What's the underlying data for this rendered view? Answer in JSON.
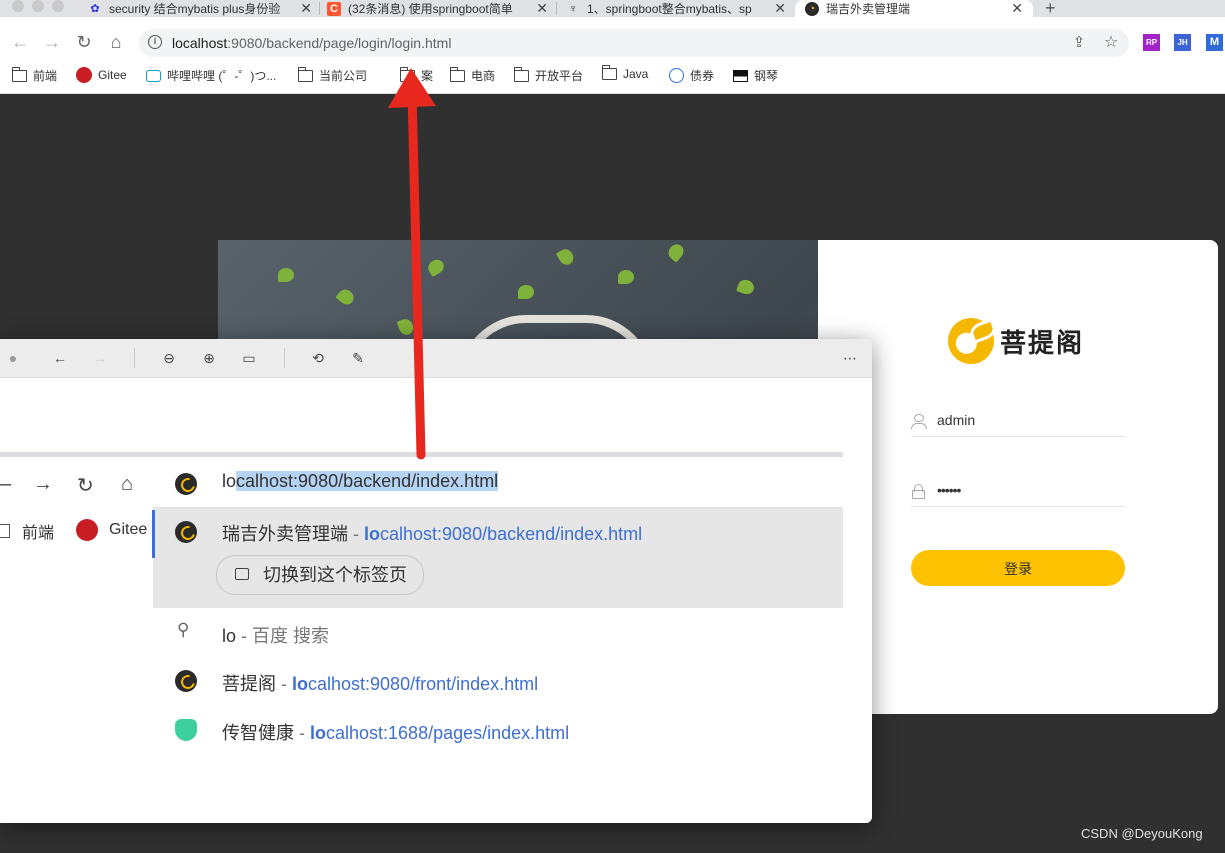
{
  "browser": {
    "tabs": [
      {
        "title": "security 结合mybatis plus身份验",
        "favicon": "baidu-paw-icon"
      },
      {
        "title": "(32条消息) 使用springboot简单",
        "favicon": "csdn-icon"
      },
      {
        "title": "1、springboot整合mybatis、sp",
        "favicon": "github-like-icon"
      },
      {
        "title": "瑞吉外卖管理端",
        "favicon": "reggie-logo-icon"
      }
    ],
    "url_host": "localhost",
    "url_rest": ":9080/backend/page/login/login.html",
    "extensions": [
      "RP",
      "JH",
      "M"
    ]
  },
  "bookmarks": [
    {
      "label": "前端",
      "icon": "folder-icon"
    },
    {
      "label": "Gitee",
      "icon": "gitee-icon"
    },
    {
      "label": "哔哩哔哩 (゜-゜)つ...",
      "icon": "bilibili-icon"
    },
    {
      "label": "当前公司",
      "icon": "folder-icon"
    },
    {
      "label": "案",
      "icon": "folder-icon"
    },
    {
      "label": "电商",
      "icon": "folder-icon"
    },
    {
      "label": "开放平台",
      "icon": "folder-icon"
    },
    {
      "label": "Java",
      "icon": "folder-icon"
    },
    {
      "label": "债券",
      "icon": "bond-icon"
    },
    {
      "label": "钢琴",
      "icon": "piano-icon"
    }
  ],
  "login": {
    "brand": "菩提阁",
    "username": "admin",
    "password_mask": "••••••",
    "submit_label": "登录"
  },
  "preview": {
    "bookmarks": [
      "前端",
      "Gitee"
    ],
    "omnibox_typed": "lo",
    "omnibox_autocomplete": "calhost:9080/backend/index.html",
    "suggestions": [
      {
        "title": "瑞吉外卖管理端",
        "sep": " - ",
        "match": "lo",
        "rest": "calhost:9080/backend/index.html"
      },
      {
        "title": "lo",
        "sep": " - ",
        "extra": "百度 搜索"
      },
      {
        "title": "菩提阁",
        "sep": " - ",
        "match": "lo",
        "rest": "calhost:9080/front/index.html"
      },
      {
        "title": "传智健康",
        "sep": " - ",
        "match": "lo",
        "rest": "calhost:1688/pages/index.html"
      }
    ],
    "switch_tab_label": "切换到这个标签页"
  },
  "watermark": "CSDN @DeyouKong",
  "colors": {
    "accent": "#ffc200",
    "link": "#3e6fd0",
    "arrow": "#e8281e"
  }
}
